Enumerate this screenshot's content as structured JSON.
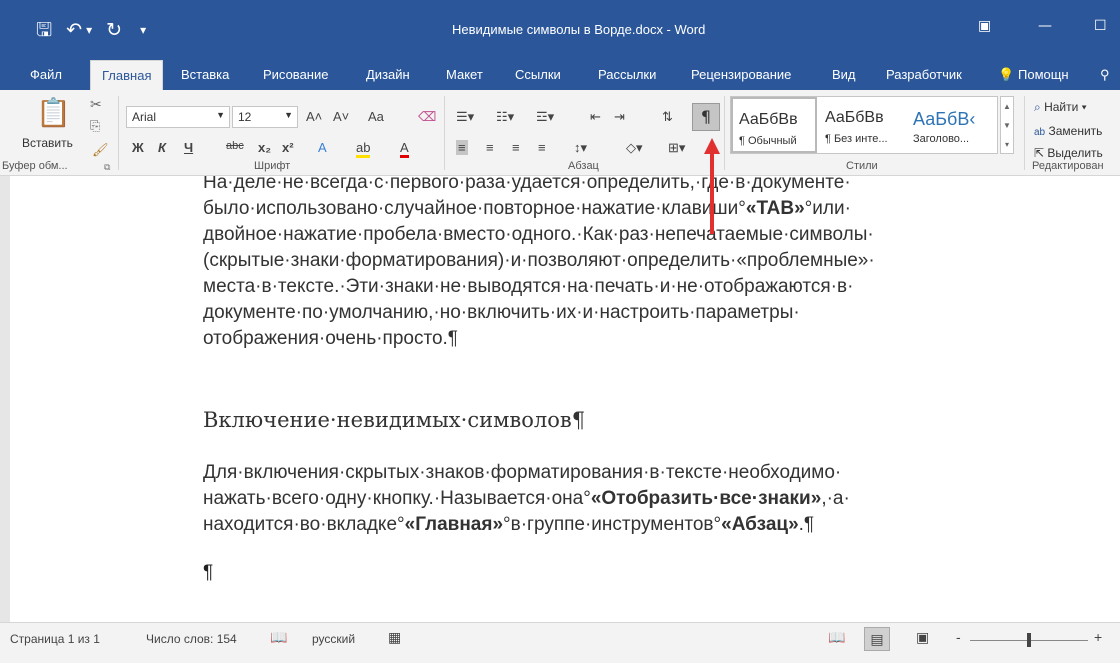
{
  "window": {
    "title": "Невидимые символы в Ворде.docx  -  Word",
    "qat": {
      "save_icon": "save-icon",
      "undo_icon": "undo-icon",
      "redo_icon": "redo-icon",
      "customize_icon": "customize-qat-icon"
    }
  },
  "tabs": [
    "Файл",
    "Главная",
    "Вставка",
    "Рисование",
    "Дизайн",
    "Макет",
    "Ссылки",
    "Рассылки",
    "Рецензирование",
    "Вид",
    "Разработчик",
    "Помощн"
  ],
  "ribbon": {
    "clipboard": {
      "paste_label": "Вставить",
      "group_label": "Буфер обм..."
    },
    "font": {
      "font_name": "Arial",
      "font_size": "12",
      "group_label": "Шрифт",
      "bold": "Ж",
      "italic": "К",
      "underline": "Ч",
      "strikethrough": "abc",
      "subscript": "x₂",
      "superscript": "x²",
      "grow": "A˄",
      "shrink": "A˅",
      "case": "Aa",
      "effects": "A",
      "highlight": "ab",
      "color": "A"
    },
    "paragraph": {
      "group_label": "Абзац",
      "pilcrow": "¶"
    },
    "styles": {
      "group_label": "Стили",
      "items": [
        {
          "sample": "АаБбВв",
          "name": "¶ Обычный"
        },
        {
          "sample": "АаБбВв",
          "name": "¶ Без инте..."
        },
        {
          "sample": "АаБбВ‹",
          "name": "Заголово..."
        }
      ]
    },
    "editing": {
      "group_label": "Редактирован",
      "find": "Найти",
      "replace": "Заменить",
      "select": "Выделить"
    }
  },
  "document": {
    "para1_lines": [
      "На·деле·не·всегда·с·первого·раза·удается·определить,·где·в·документе·",
      "было·использовано·случайное·повторное·нажатие·клавиши°«TAB»°или·",
      "двойное·нажатие·пробела·вместо·одного.·Как·раз·непечатаемые·символы·",
      "(скрытые·знаки·форматирования)·и·позволяют·определить·«проблемные»·",
      "места·в·тексте.·Эти·знаки·не·выводятся·на·печать·и·не·отображаются·в·",
      "документе·по·умолчанию,·но·включить·их·и·настроить·параметры·",
      "отображения·очень·просто.¶"
    ],
    "heading": "Включение·невидимых·символов¶",
    "para2": {
      "l1": "Для·включения·скрытых·знаков·форматирования·в·тексте·необходимо·",
      "l2a": "нажать·всего·одну·кнопку.·Называется·она°",
      "l2b": "«Отобразить·все·знаки»",
      "l2c": ",·а·",
      "l3a": "находится·во·вкладке°",
      "l3b": "«Главная»",
      "l3c": "°в·группе·инструментов°",
      "l3d": "«Абзац»",
      "l3e": ".¶"
    },
    "empty_para_mark": "¶"
  },
  "statusbar": {
    "page": "Страница 1 из 1",
    "words": "Число слов: 154",
    "language": "русский",
    "zoom_minus": "-",
    "zoom_plus": "+"
  },
  "colors": {
    "accent": "#2b579a",
    "arrow": "#e03030"
  }
}
